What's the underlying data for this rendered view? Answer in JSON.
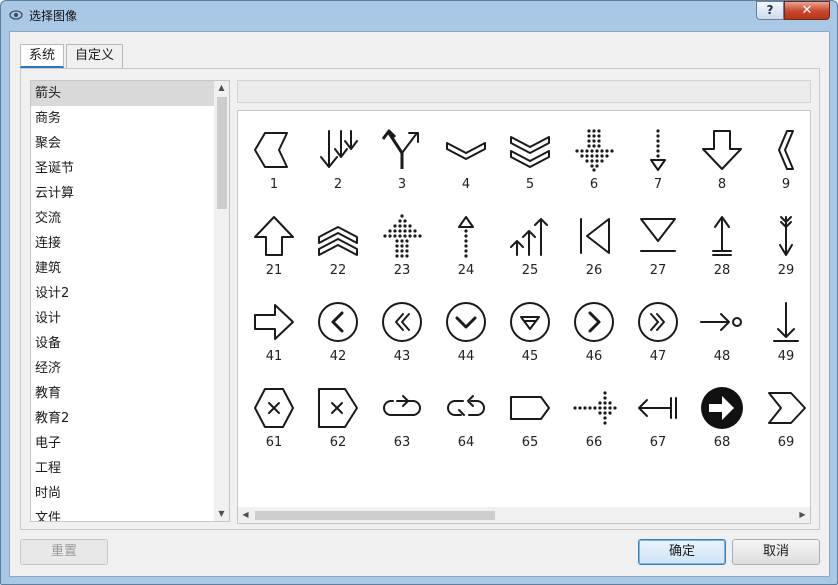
{
  "window": {
    "title": "选择图像",
    "help_label": "?",
    "close_label": "✕"
  },
  "tabs": [
    {
      "label": "系统",
      "active": true
    },
    {
      "label": "自定义",
      "active": false
    }
  ],
  "categories": [
    {
      "label": "箭头",
      "selected": true
    },
    {
      "label": "商务"
    },
    {
      "label": "聚会"
    },
    {
      "label": "圣诞节"
    },
    {
      "label": "云计算"
    },
    {
      "label": "交流"
    },
    {
      "label": "连接"
    },
    {
      "label": "建筑"
    },
    {
      "label": "设计2"
    },
    {
      "label": "设计"
    },
    {
      "label": "设备"
    },
    {
      "label": "经济"
    },
    {
      "label": "教育"
    },
    {
      "label": "教育2"
    },
    {
      "label": "电子"
    },
    {
      "label": "工程"
    },
    {
      "label": "时尚"
    },
    {
      "label": "文件"
    }
  ],
  "gallery": {
    "rows": [
      [
        {
          "num": "1",
          "icon": "chevron-left-outline-icon"
        },
        {
          "num": "2",
          "icon": "double-down-arrows-icon"
        },
        {
          "num": "3",
          "icon": "split-arrow-icon"
        },
        {
          "num": "4",
          "icon": "chevron-down-outline-icon"
        },
        {
          "num": "5",
          "icon": "double-chevron-down-icon"
        },
        {
          "num": "6",
          "icon": "dotted-arrow-down-icon"
        },
        {
          "num": "7",
          "icon": "dotted-line-arrow-down-icon"
        },
        {
          "num": "8",
          "icon": "block-arrow-down-icon"
        },
        {
          "num": "9",
          "icon": "chevron-left-narrow-icon"
        }
      ],
      [
        {
          "num": "21",
          "icon": "block-arrow-up-icon"
        },
        {
          "num": "22",
          "icon": "double-chevron-up-icon"
        },
        {
          "num": "23",
          "icon": "dotted-arrow-up-icon"
        },
        {
          "num": "24",
          "icon": "dotted-line-arrow-up-icon"
        },
        {
          "num": "25",
          "icon": "triple-up-arrows-icon"
        },
        {
          "num": "26",
          "icon": "triangle-left-bar-icon"
        },
        {
          "num": "27",
          "icon": "triangle-down-bar-icon"
        },
        {
          "num": "28",
          "icon": "arrow-up-base-icon"
        },
        {
          "num": "29",
          "icon": "feathered-arrow-down-icon"
        }
      ],
      [
        {
          "num": "41",
          "icon": "block-arrow-right-icon"
        },
        {
          "num": "42",
          "icon": "circle-chevron-left-icon"
        },
        {
          "num": "43",
          "icon": "circle-double-chevron-left-icon"
        },
        {
          "num": "44",
          "icon": "circle-chevron-down-icon"
        },
        {
          "num": "45",
          "icon": "circle-triangle-down-icon"
        },
        {
          "num": "46",
          "icon": "circle-chevron-right-icon"
        },
        {
          "num": "47",
          "icon": "circle-double-chevron-right-icon"
        },
        {
          "num": "48",
          "icon": "arrow-right-circle-end-icon"
        },
        {
          "num": "49",
          "icon": "arrow-down-bar-icon"
        }
      ],
      [
        {
          "num": "61",
          "icon": "hexagon-x-icon"
        },
        {
          "num": "62",
          "icon": "tag-x-icon"
        },
        {
          "num": "63",
          "icon": "loop-arrow-icon"
        },
        {
          "num": "64",
          "icon": "double-loop-arrow-icon"
        },
        {
          "num": "65",
          "icon": "tag-shape-icon"
        },
        {
          "num": "66",
          "icon": "dotted-arrow-right-icon"
        },
        {
          "num": "67",
          "icon": "arrow-left-bar-icon"
        },
        {
          "num": "68",
          "icon": "filled-circle-arrow-right-icon"
        },
        {
          "num": "69",
          "icon": "chevron-right-outline-icon"
        }
      ]
    ]
  },
  "buttons": {
    "reset": "重置",
    "ok": "确定",
    "cancel": "取消"
  }
}
